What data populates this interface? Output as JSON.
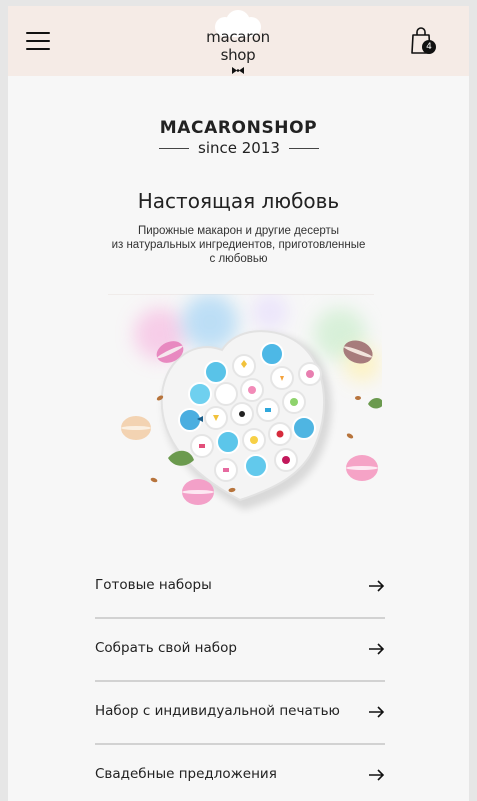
{
  "header": {
    "logo_line1": "macaron",
    "logo_line2": "shop",
    "cart_count": "4",
    "background": "#f5ebe6"
  },
  "brand": {
    "name": "MACARONSHOP",
    "since": "since 2013"
  },
  "hero": {
    "headline": "Настоящая любовь",
    "subtitle_lines": [
      "Пирожные макарон и другие десерты",
      "из натуральных ингредиентов, приготовленные",
      "с любовью"
    ]
  },
  "menu": {
    "items": [
      {
        "label": "Готовые наборы"
      },
      {
        "label": "Собрать свой набор"
      },
      {
        "label": "Набор с индивидуальной печатью"
      },
      {
        "label": "Свадебные предложения"
      }
    ]
  },
  "icons": {
    "menu": "hamburger-icon",
    "cart": "shopping-bag-icon",
    "arrow": "arrow-right-icon",
    "logo_decoration": "cloud-icon",
    "bow": "bow-tie-icon"
  }
}
